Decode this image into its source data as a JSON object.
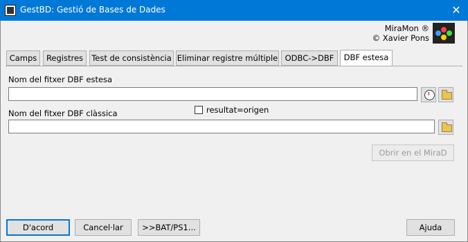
{
  "window": {
    "title": "GestBD: Gestió de Bases de Dades",
    "close_symbol": "✕"
  },
  "brand": {
    "line1": "MiraMon ®",
    "line2": "© Xavier Pons"
  },
  "tabs": [
    {
      "label": "Camps"
    },
    {
      "label": "Registres"
    },
    {
      "label": "Test de consistència"
    },
    {
      "label": "Eliminar registre múltiple"
    },
    {
      "label": "ODBC->DBF"
    },
    {
      "label": "DBF estesa"
    }
  ],
  "form": {
    "extended_label": "Nom del fitxer DBF estesa",
    "extended_value": "",
    "classic_label": "Nom del fitxer DBF clàssica",
    "classic_value": "",
    "checkbox_label": "resultat=origen",
    "checkbox_checked": false,
    "open_mirad_label": "Obrir en el MiraD"
  },
  "footer": {
    "ok_label": "D'acord",
    "cancel_label": "Cancel·lar",
    "bat_label": ">>BAT/PS1...",
    "help_label": "Ajuda"
  }
}
